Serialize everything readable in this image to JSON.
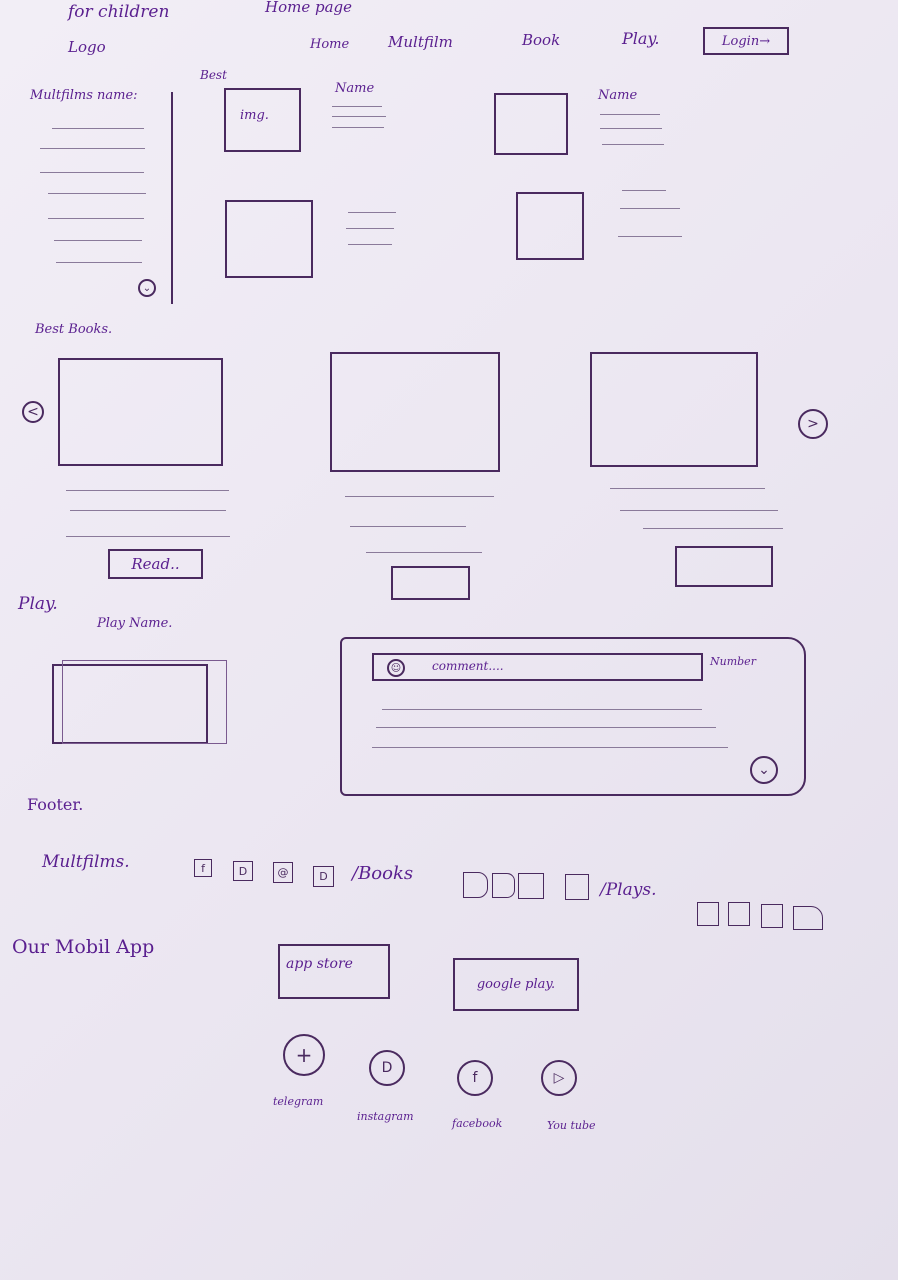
{
  "header": {
    "tagline": "for children",
    "page_title": "Home page",
    "logo": "Logo",
    "nav": [
      "Home",
      "Multfilm",
      "Book",
      "Play."
    ],
    "login_label": "Login→"
  },
  "multfilms": {
    "sidebar_title": "Multfilms name:",
    "best_label": "Best",
    "img_label": "img.",
    "name_label": "Name",
    "down_icon": "down-arrow-icon"
  },
  "books": {
    "title": "Best Books.",
    "read_label": "Read.."
  },
  "play": {
    "title": "Play.",
    "play_name": "Play Name.",
    "comment_placeholder": "comment....",
    "number_label": "Number"
  },
  "footer": {
    "title": "Footer.",
    "multfilms_label": "Multfilms.",
    "books_label": "/Books",
    "plays_label": "/Plays.",
    "mobile_app_label": "Our Mobil App",
    "app_store_label": "app store",
    "google_play_label": "google play.",
    "social": [
      "telegram",
      "instagram",
      "facebook",
      "You tube"
    ]
  }
}
